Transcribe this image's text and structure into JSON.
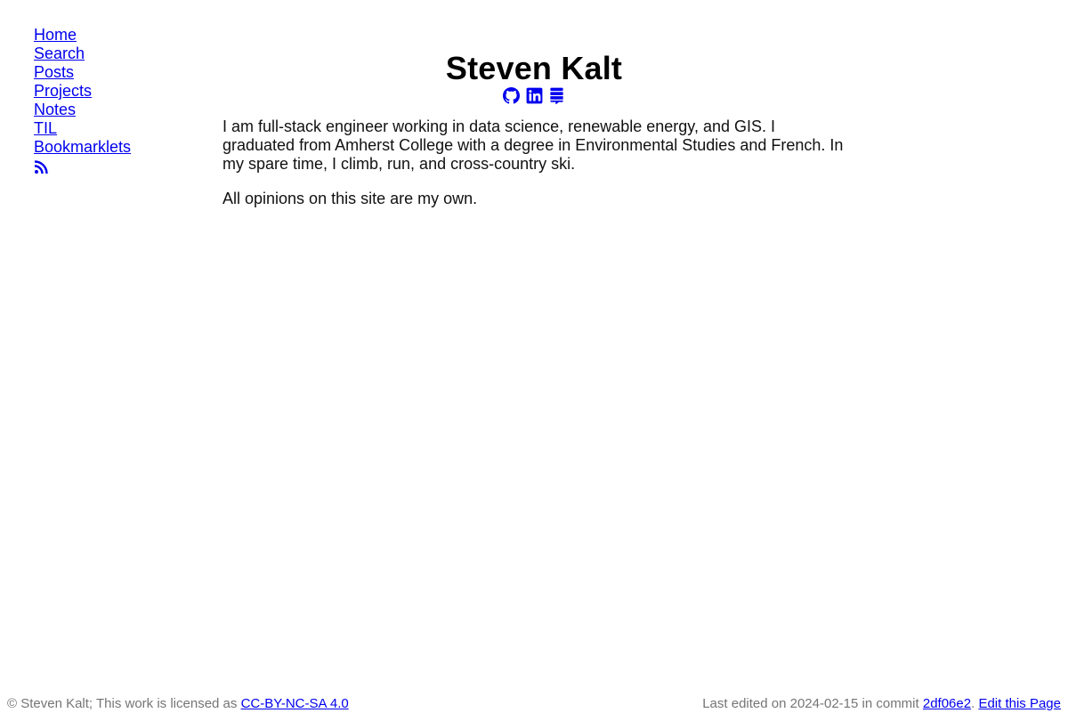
{
  "nav": {
    "items": [
      {
        "label": "Home"
      },
      {
        "label": "Search"
      },
      {
        "label": "Posts"
      },
      {
        "label": "Projects"
      },
      {
        "label": "Notes"
      },
      {
        "label": "TIL"
      },
      {
        "label": "Bookmarklets"
      }
    ],
    "rss_icon": "rss-icon"
  },
  "header": {
    "title": "Steven Kalt",
    "social_icons": [
      "github-icon",
      "linkedin-icon",
      "stackexchange-icon"
    ]
  },
  "bio": {
    "paragraph1": "I am full-stack engineer working in data science, renewable energy, and GIS. I graduated from Amherst College with a degree in Environmental Studies and French. In my spare time, I climb, run, and cross-country ski.",
    "paragraph2": "All opinions on this site are my own."
  },
  "footer": {
    "copyright_text": "© Steven Kalt; This work is licensed as ",
    "license_link": "CC-BY-NC-SA 4.0",
    "last_edited_text": "Last edited on 2024-02-15 in commit ",
    "commit_link": "2df06e2",
    "separator": ". ",
    "edit_link": "Edit this Page"
  },
  "colors": {
    "link": "#0000ee",
    "footer_text": "#757575",
    "icon": "#0000ee"
  }
}
